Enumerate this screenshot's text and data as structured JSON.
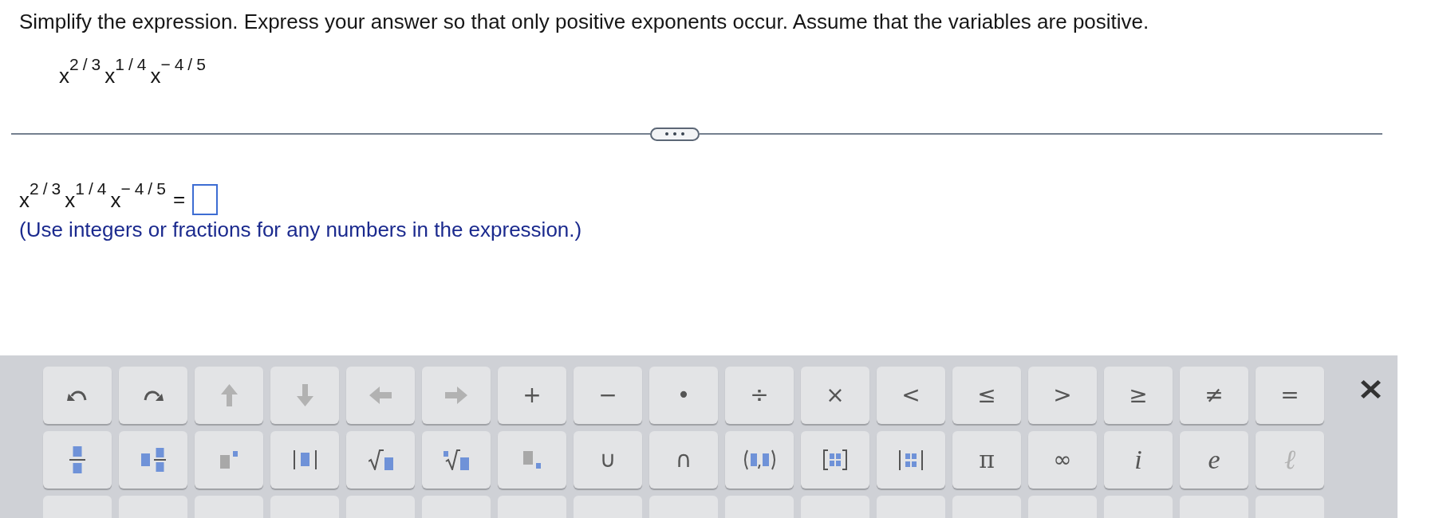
{
  "question": {
    "instruction": "Simplify the expression. Express your answer so that only positive exponents occur. Assume that the variables are positive.",
    "expression": "x$^{2/3}$x$^{1/4}$x$^{−4/5}$"
  },
  "answer": {
    "expression": "x$^{2/3}$x$^{1/4}$x$^{−4/5}$",
    "relation": "=",
    "hint": "(Use integers or fractions for any numbers in the expression.)"
  },
  "keyboard": {
    "rows": [
      {
        "keys": [
          {
            "kind": "undo",
            "disabled": false
          },
          {
            "kind": "redo",
            "disabled": false
          },
          {
            "kind": "up",
            "disabled": true
          },
          {
            "kind": "down",
            "disabled": true
          },
          {
            "kind": "left",
            "disabled": true
          },
          {
            "kind": "right",
            "disabled": true
          },
          {
            "kind": "symbol",
            "label": "+",
            "disabled": false
          },
          {
            "kind": "symbol",
            "label": "−",
            "disabled": false
          },
          {
            "kind": "symbol",
            "label": "•",
            "disabled": false
          },
          {
            "kind": "symbol",
            "label": "÷",
            "disabled": false
          },
          {
            "kind": "symbol",
            "label": "×",
            "disabled": false
          },
          {
            "kind": "symbol",
            "label": "<",
            "disabled": false
          },
          {
            "kind": "symbol",
            "label": "≤",
            "disabled": false
          },
          {
            "kind": "symbol",
            "label": ">",
            "disabled": false
          },
          {
            "kind": "symbol",
            "label": "≥",
            "disabled": false
          },
          {
            "kind": "symbol",
            "label": "≠",
            "disabled": false
          },
          {
            "kind": "symbol",
            "label": "=",
            "disabled": false
          }
        ]
      },
      {
        "keys": [
          {
            "kind": "fraction",
            "disabled": false
          },
          {
            "kind": "mixed",
            "disabled": false
          },
          {
            "kind": "power",
            "disabled": false
          },
          {
            "kind": "abs",
            "disabled": false
          },
          {
            "kind": "sqrt",
            "disabled": false
          },
          {
            "kind": "root",
            "disabled": false
          },
          {
            "kind": "subscript",
            "disabled": false
          },
          {
            "kind": "symbol",
            "label": "∪",
            "disabled": false
          },
          {
            "kind": "symbol",
            "label": "∩",
            "disabled": false
          },
          {
            "kind": "interval",
            "disabled": false
          },
          {
            "kind": "matrix",
            "disabled": false
          },
          {
            "kind": "determinant",
            "disabled": false
          },
          {
            "kind": "serif",
            "label": "π",
            "disabled": false
          },
          {
            "kind": "symbol",
            "label": "∞",
            "disabled": false
          },
          {
            "kind": "italic",
            "label": "i",
            "disabled": false
          },
          {
            "kind": "italic",
            "label": "e",
            "disabled": false
          },
          {
            "kind": "italic",
            "label": "ℓ",
            "disabled": true
          }
        ]
      },
      {
        "keys": [
          {
            "kind": "partial"
          },
          {
            "kind": "partial"
          },
          {
            "kind": "partial"
          },
          {
            "kind": "partial"
          },
          {
            "kind": "partial"
          },
          {
            "kind": "partial"
          },
          {
            "kind": "partial"
          },
          {
            "kind": "partial"
          },
          {
            "kind": "partial"
          },
          {
            "kind": "partial"
          },
          {
            "kind": "partial"
          },
          {
            "kind": "partial"
          },
          {
            "kind": "partial"
          },
          {
            "kind": "partial"
          },
          {
            "kind": "partial"
          },
          {
            "kind": "partial"
          },
          {
            "kind": "partial"
          }
        ]
      }
    ]
  }
}
